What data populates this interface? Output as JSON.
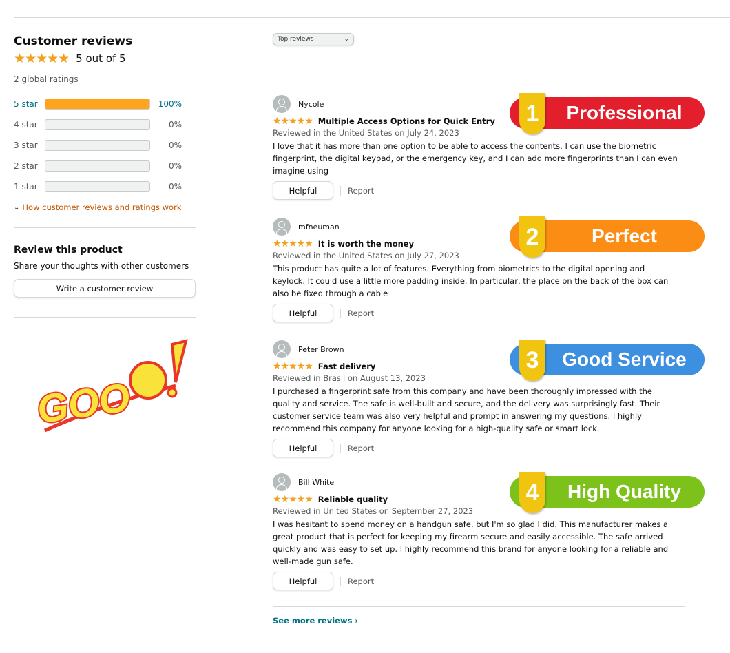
{
  "summary": {
    "title": "Customer reviews",
    "stars": "★★★★★",
    "rating_text": "5 out of 5",
    "global_ratings": "2 global ratings",
    "histogram": [
      {
        "label": "5 star",
        "percent": 100,
        "percent_text": "100%"
      },
      {
        "label": "4 star",
        "percent": 0,
        "percent_text": "0%"
      },
      {
        "label": "3 star",
        "percent": 0,
        "percent_text": "0%"
      },
      {
        "label": "2 star",
        "percent": 0,
        "percent_text": "0%"
      },
      {
        "label": "1 star",
        "percent": 0,
        "percent_text": "0%"
      }
    ],
    "how_link": "How customer reviews and ratings work"
  },
  "review_product": {
    "title": "Review this product",
    "subtitle": "Share your thoughts with other customers",
    "button": "Write a customer review"
  },
  "logo_text": "GOOD!",
  "sort": {
    "selected": "Top reviews"
  },
  "reviews": [
    {
      "author": "Nycole",
      "stars": "★★★★★",
      "title": "Multiple Access Options for Quick Entry",
      "meta": "Reviewed in the United States on July 24, 2023",
      "body": "I love that it has more than one option to be able to access the contents, I can use the biometric fingerprint, the digital keypad, or the emergency key, and I can add more fingerprints than I can even imagine using",
      "helpful": "Helpful",
      "report": "Report"
    },
    {
      "author": "mfneuman",
      "stars": "★★★★★",
      "title": "It is worth the money",
      "meta": "Reviewed in the United States on July 27, 2023",
      "body": "This product has quite a lot of features. Everything from biometrics to the digital opening and keylock. It could use a little more padding inside. In particular, the place on the back of the box can also be fixed through a cable",
      "helpful": "Helpful",
      "report": "Report"
    },
    {
      "author": "Peter Brown",
      "stars": "★★★★★",
      "title": "Fast delivery",
      "meta": "Reviewed in Brasil on August 13, 2023",
      "body": "I purchased a fingerprint safe from this company and have been thoroughly impressed with the quality and service. The safe is well-built and secure, and the delivery was surprisingly fast. Their customer service team was also very helpful and prompt in answering my questions. I highly recommend this company for anyone looking for a high-quality safe or smart lock.",
      "helpful": "Helpful",
      "report": "Report"
    },
    {
      "author": "Bill White",
      "stars": "★★★★★",
      "title": "Reliable quality",
      "meta": "Reviewed in United States on September 27, 2023",
      "body": "I was hesitant to spend money on a handgun safe, but I'm so glad I did. This manufacturer makes a great product that is perfect for keeping my firearm secure and easily accessible. The safe arrived quickly and was easy to set up. I highly recommend this brand for anyone looking for a reliable and well-made gun safe.",
      "helpful": "Helpful",
      "report": "Report"
    }
  ],
  "badges": [
    {
      "number": "1",
      "text": "Professional",
      "color": "#e31e2d"
    },
    {
      "number": "2",
      "text": "Perfect",
      "color": "#fb8c14"
    },
    {
      "number": "3",
      "text": "Good Service",
      "color": "#3d8fe0"
    },
    {
      "number": "4",
      "text": "High Quality",
      "color": "#7cc21b"
    }
  ],
  "see_more": "See more reviews ›"
}
